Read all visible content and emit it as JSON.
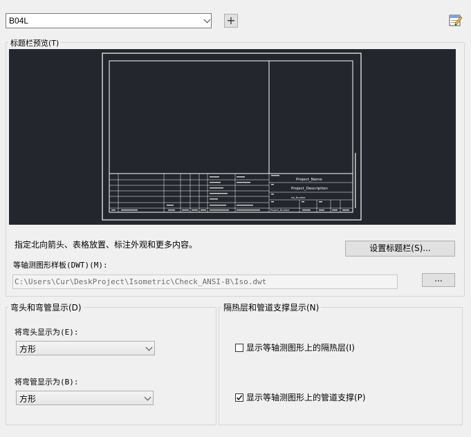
{
  "title_block_style": {
    "selected": "B04L"
  },
  "preview_group": {
    "label": "标题栏预览(T)",
    "preview_texts": {
      "project_name": "Project_Name",
      "project_description": "Project_Description",
      "iso_number": "Iso_Number",
      "project_number": "Project_Number"
    }
  },
  "description": "指定北向箭头、表格放置、标注外观和更多内容。",
  "setup_button": "设置标题栏(S)...",
  "template": {
    "label": "等轴测图形样板(DWT)(M):",
    "path": "C:\\Users\\Cur\\DeskProject\\Isometric\\Check_ANSI-B\\Iso.dwt",
    "browse_label": "..."
  },
  "elbow_group": {
    "label": "弯头和弯管显示(D)",
    "elbow_label": "将弯头显示为(E):",
    "elbow_value": "方形",
    "bend_label": "将弯管显示为(B):",
    "bend_value": "方形"
  },
  "insulation_group": {
    "label": "隔热层和管道支撑显示(N)",
    "show_insulation_label": "显示等轴测图形上的隔热层(I)",
    "show_insulation_checked": false,
    "show_supports_label": "显示等轴测图形上的管道支撑(P)",
    "show_supports_checked": true
  }
}
